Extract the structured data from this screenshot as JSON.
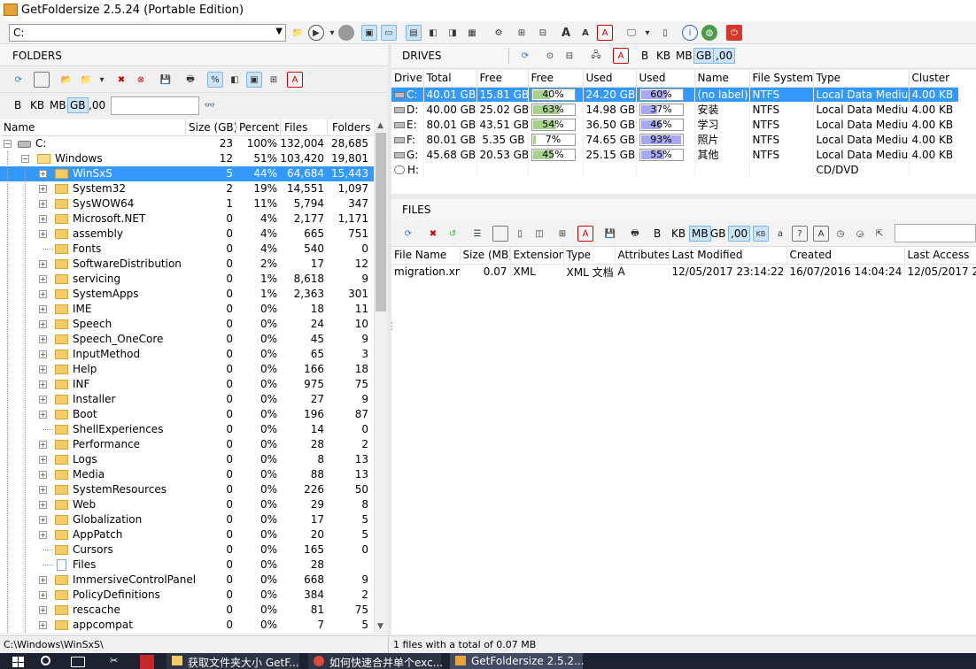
{
  "title": "GetFoldersize 2.5.24 (Portable Edition)",
  "path_combo": "C:",
  "folders_header": "FOLDERS",
  "drives_header": "DRIVES",
  "files_header": "FILES",
  "units": [
    "B",
    "KB",
    "MB",
    "GB",
    ",00"
  ],
  "folder_columns": [
    "Name",
    "Size (GB)",
    "Percent",
    "Files",
    "Folders"
  ],
  "root": {
    "name": "C:",
    "size": "23",
    "percent": "100%",
    "files": "132,004",
    "folders": "28,685"
  },
  "windows": {
    "name": "Windows",
    "size": "12",
    "percent": "51%",
    "files": "103,420",
    "folders": "19,801"
  },
  "folders": [
    {
      "name": "WinSxS",
      "size": "5",
      "percent": "44%",
      "files": "64,684",
      "folders": "15,443",
      "exp": true,
      "sel": true
    },
    {
      "name": "System32",
      "size": "2",
      "percent": "19%",
      "files": "14,551",
      "folders": "1,097",
      "exp": true
    },
    {
      "name": "SysWOW64",
      "size": "1",
      "percent": "11%",
      "files": "5,794",
      "folders": "347",
      "exp": true
    },
    {
      "name": "Microsoft.NET",
      "size": "0",
      "percent": "4%",
      "files": "2,177",
      "folders": "1,171",
      "exp": true
    },
    {
      "name": "assembly",
      "size": "0",
      "percent": "4%",
      "files": "665",
      "folders": "751",
      "exp": true
    },
    {
      "name": "Fonts",
      "size": "0",
      "percent": "4%",
      "files": "540",
      "folders": "0",
      "exp": false
    },
    {
      "name": "SoftwareDistribution",
      "size": "0",
      "percent": "2%",
      "files": "17",
      "folders": "12",
      "exp": true
    },
    {
      "name": "servicing",
      "size": "0",
      "percent": "1%",
      "files": "8,618",
      "folders": "9",
      "exp": true
    },
    {
      "name": "SystemApps",
      "size": "0",
      "percent": "1%",
      "files": "2,363",
      "folders": "301",
      "exp": true
    },
    {
      "name": "IME",
      "size": "0",
      "percent": "0%",
      "files": "18",
      "folders": "11",
      "exp": true
    },
    {
      "name": "Speech",
      "size": "0",
      "percent": "0%",
      "files": "24",
      "folders": "10",
      "exp": true
    },
    {
      "name": "Speech_OneCore",
      "size": "0",
      "percent": "0%",
      "files": "45",
      "folders": "9",
      "exp": true
    },
    {
      "name": "InputMethod",
      "size": "0",
      "percent": "0%",
      "files": "65",
      "folders": "3",
      "exp": true
    },
    {
      "name": "Help",
      "size": "0",
      "percent": "0%",
      "files": "166",
      "folders": "18",
      "exp": true
    },
    {
      "name": "INF",
      "size": "0",
      "percent": "0%",
      "files": "975",
      "folders": "75",
      "exp": true
    },
    {
      "name": "Installer",
      "size": "0",
      "percent": "0%",
      "files": "27",
      "folders": "9",
      "exp": true
    },
    {
      "name": "Boot",
      "size": "0",
      "percent": "0%",
      "files": "196",
      "folders": "87",
      "exp": true
    },
    {
      "name": "ShellExperiences",
      "size": "0",
      "percent": "0%",
      "files": "14",
      "folders": "0",
      "exp": false
    },
    {
      "name": "Performance",
      "size": "0",
      "percent": "0%",
      "files": "28",
      "folders": "2",
      "exp": true
    },
    {
      "name": "Logs",
      "size": "0",
      "percent": "0%",
      "files": "8",
      "folders": "13",
      "exp": true
    },
    {
      "name": "Media",
      "size": "0",
      "percent": "0%",
      "files": "88",
      "folders": "13",
      "exp": true
    },
    {
      "name": "SystemResources",
      "size": "0",
      "percent": "0%",
      "files": "226",
      "folders": "50",
      "exp": true
    },
    {
      "name": "Web",
      "size": "0",
      "percent": "0%",
      "files": "29",
      "folders": "8",
      "exp": true
    },
    {
      "name": "Globalization",
      "size": "0",
      "percent": "0%",
      "files": "17",
      "folders": "5",
      "exp": true
    },
    {
      "name": "AppPatch",
      "size": "0",
      "percent": "0%",
      "files": "20",
      "folders": "5",
      "exp": true
    },
    {
      "name": "Cursors",
      "size": "0",
      "percent": "0%",
      "files": "165",
      "folders": "0",
      "exp": false
    },
    {
      "name": "Files",
      "size": "0",
      "percent": "0%",
      "files": "28",
      "folders": "",
      "exp": false,
      "file": true
    },
    {
      "name": "ImmersiveControlPanel",
      "size": "0",
      "percent": "0%",
      "files": "668",
      "folders": "9",
      "exp": true
    },
    {
      "name": "PolicyDefinitions",
      "size": "0",
      "percent": "0%",
      "files": "384",
      "folders": "2",
      "exp": true
    },
    {
      "name": "rescache",
      "size": "0",
      "percent": "0%",
      "files": "81",
      "folders": "75",
      "exp": true
    },
    {
      "name": "appcompat",
      "size": "0",
      "percent": "0%",
      "files": "7",
      "folders": "5",
      "exp": true
    }
  ],
  "drive_columns": [
    "Drive",
    "Total",
    "Free",
    "Free",
    "Used",
    "Used",
    "Name",
    "File System",
    "Type",
    "Cluster"
  ],
  "drives": [
    {
      "drive": "C:",
      "total": "40.01 GB",
      "free": "15.81 GB",
      "free_pct": "40%",
      "free_frac": 0.4,
      "used": "24.20 GB",
      "used_pct": "60%",
      "used_frac": 0.6,
      "name": "(no label)",
      "fs": "NTFS",
      "type": "Local Data Medium",
      "cluster": "4.00 KB",
      "sel": true
    },
    {
      "drive": "D:",
      "total": "40.00 GB",
      "free": "25.02 GB",
      "free_pct": "63%",
      "free_frac": 0.63,
      "used": "14.98 GB",
      "used_pct": "37%",
      "used_frac": 0.37,
      "name": "安装",
      "fs": "NTFS",
      "type": "Local Data Medium",
      "cluster": "4.00 KB"
    },
    {
      "drive": "E:",
      "total": "80.01 GB",
      "free": "43.51 GB",
      "free_pct": "54%",
      "free_frac": 0.54,
      "used": "36.50 GB",
      "used_pct": "46%",
      "used_frac": 0.46,
      "name": "学习",
      "fs": "NTFS",
      "type": "Local Data Medium",
      "cluster": "4.00 KB"
    },
    {
      "drive": "F:",
      "total": "80.01 GB",
      "free": "5.35 GB",
      "free_pct": "7%",
      "free_frac": 0.07,
      "used": "74.65 GB",
      "used_pct": "93%",
      "used_frac": 0.93,
      "name": "照片",
      "fs": "NTFS",
      "type": "Local Data Medium",
      "cluster": "4.00 KB"
    },
    {
      "drive": "G:",
      "total": "45.68 GB",
      "free": "20.53 GB",
      "free_pct": "45%",
      "free_frac": 0.45,
      "used": "25.15 GB",
      "used_pct": "55%",
      "used_frac": 0.55,
      "name": "其他",
      "fs": "NTFS",
      "type": "Local Data Medium",
      "cluster": "4.00 KB"
    },
    {
      "drive": "H:",
      "total": "",
      "free": "",
      "free_pct": "",
      "used": "",
      "used_pct": "",
      "name": "",
      "fs": "",
      "type": "CD/DVD",
      "cluster": "",
      "optical": true
    }
  ],
  "file_columns": [
    "File Name",
    "Size (MB)",
    "Extension",
    "Type",
    "Attributes",
    "Last Modified",
    "Created",
    "Last Access"
  ],
  "files": [
    {
      "name": "migration.xml",
      "size": "0.07",
      "ext": "XML",
      "type": "XML 文档",
      "attr": "A",
      "modified": "12/05/2017 23:14:22",
      "created": "16/07/2016 14:04:24",
      "access": "12/05/2017 2"
    }
  ],
  "status_left": "C:\\Windows\\WinSxS\\",
  "status_right": "1 files with a total of 0.07 MB",
  "taskbar": [
    "获取文件夹大小 GetF...",
    "如何快速合并单个exc...",
    "GetFoldersize 2.5.2..."
  ],
  "colors": {
    "selection": "#3399ff",
    "free_bar": "#a9d18e",
    "used_bar": "#a8a8f0",
    "folder": "#f3cc68"
  }
}
